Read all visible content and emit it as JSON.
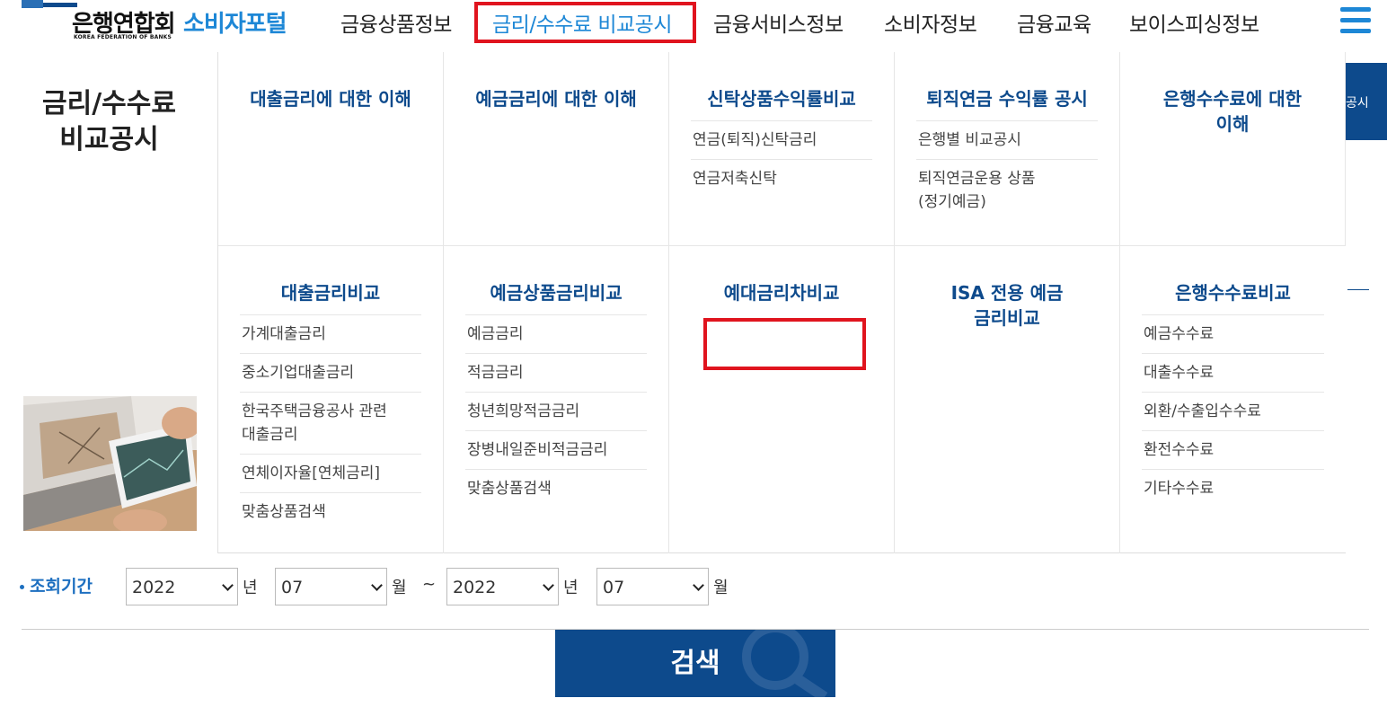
{
  "header": {
    "logo_ko": "은행연합회",
    "logo_en": "KOREA FEDERATION OF BANKS",
    "portal": "소비자포털",
    "nav": [
      {
        "label": "금융상품정보"
      },
      {
        "label": "금리/수수료 비교공시"
      },
      {
        "label": "금융서비스정보"
      },
      {
        "label": "소비자정보"
      },
      {
        "label": "금융교육"
      },
      {
        "label": "보이스피싱정보"
      }
    ],
    "menu_icon": "hamburger-icon"
  },
  "mega_menu": {
    "title_line1": "금리/수수료",
    "title_line2": "비교공시",
    "row1": [
      {
        "title": "대출금리에 대한 이해",
        "items": []
      },
      {
        "title": "예금금리에 대한 이해",
        "items": []
      },
      {
        "title": "신탁상품수익률비교",
        "items": [
          "연금(퇴직)신탁금리",
          "연금저축신탁"
        ]
      },
      {
        "title": "퇴직연금 수익률 공시",
        "items": [
          "은행별 비교공시",
          "퇴직연금운용 상품",
          "(정기예금)"
        ]
      },
      {
        "title_line1": "은행수수료에 대한",
        "title_line2": "이해",
        "items": []
      }
    ],
    "row2": [
      {
        "title": "대출금리비교",
        "items": [
          "가계대출금리",
          "중소기업대출금리",
          "한국주택금융공사 관련",
          "대출금리",
          "연체이자율[연체금리]",
          "맞춤상품검색"
        ]
      },
      {
        "title": "예금상품금리비교",
        "items": [
          "예금금리",
          "적금금리",
          "청년희망적금금리",
          "장병내일준비적금금리",
          "맞춤상품검색"
        ]
      },
      {
        "title": "예대금리차비교",
        "items": []
      },
      {
        "title_line1": "ISA 전용 예금",
        "title_line2": "금리비교",
        "items": []
      },
      {
        "title": "은행수수료비교",
        "items": [
          "예금수수료",
          "대출수수료",
          "외환/수출입수수료",
          "환전수수료",
          "기타수수료"
        ]
      }
    ]
  },
  "side_strip": {
    "text": "공시"
  },
  "search_form": {
    "period_label": "조회기간",
    "from_year": "2022",
    "from_month": "07",
    "to_year": "2022",
    "to_month": "07",
    "unit_year": "년",
    "unit_month": "월",
    "tilde": "~",
    "search_button": "검색"
  },
  "colors": {
    "brand_blue": "#0d4a8c",
    "accent_blue": "#1d87d6",
    "highlight_red": "#e0141e"
  }
}
